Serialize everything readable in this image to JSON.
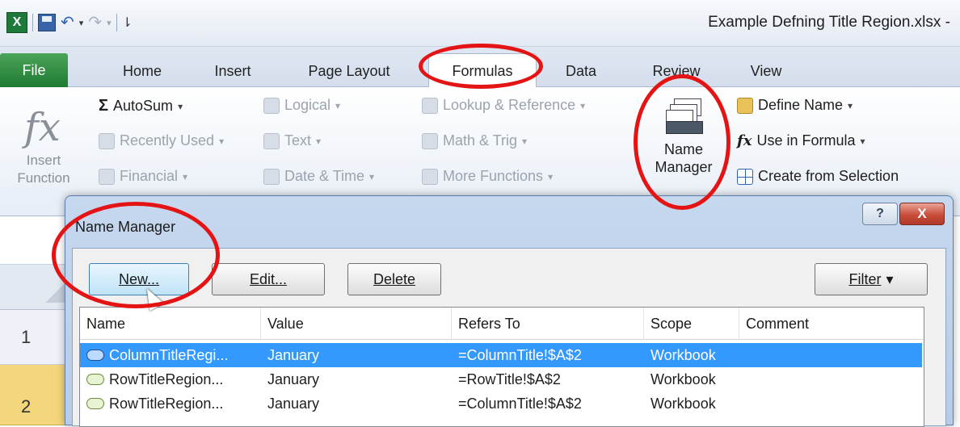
{
  "window": {
    "title": "Example Defning Title Region.xlsx -"
  },
  "qat": {
    "app_letter": "X",
    "undo_glyph": "↶",
    "redo_glyph": "↷",
    "dropdown_glyph": "▾",
    "customize_glyph": "⇂"
  },
  "tabs": [
    {
      "label": "File"
    },
    {
      "label": "Home"
    },
    {
      "label": "Insert"
    },
    {
      "label": "Page Layout"
    },
    {
      "label": "Formulas"
    },
    {
      "label": "Data"
    },
    {
      "label": "Review"
    },
    {
      "label": "View"
    }
  ],
  "ribbon": {
    "insert_function": {
      "glyph": "fx",
      "line1": "Insert",
      "line2": "Function"
    },
    "autosum": {
      "glyph": "Σ",
      "label": "AutoSum"
    },
    "recently_used": "Recently Used",
    "financial": "Financial",
    "logical": "Logical",
    "text": "Text",
    "date_time": "Date & Time",
    "lookup_reference": "Lookup & Reference",
    "math_trig": "Math & Trig",
    "more_functions": "More Functions",
    "name_manager": {
      "line1": "Name",
      "line2": "Manager"
    },
    "define_name": "Define Name",
    "use_in_formula": "Use in Formula",
    "create_from_selection": "Create from Selection",
    "caret": "▾",
    "fx_small": "fx"
  },
  "worksheet": {
    "rows": [
      "1",
      "2"
    ]
  },
  "dialog": {
    "title": "Name Manager",
    "help": "?",
    "close": "X",
    "buttons": {
      "new": "New...",
      "edit": "Edit...",
      "delete": "Delete",
      "filter": "Filter",
      "filter_caret": "▾"
    },
    "columns": [
      "Name",
      "Value",
      "Refers To",
      "Scope",
      "Comment"
    ],
    "rows": [
      {
        "name": "ColumnTitleRegi...",
        "value": "January",
        "refers_to": "=ColumnTitle!$A$2",
        "scope": "Workbook",
        "comment": "",
        "selected": true
      },
      {
        "name": "RowTitleRegion...",
        "value": "January",
        "refers_to": "=RowTitle!$A$2",
        "scope": "Workbook",
        "comment": "",
        "selected": false
      },
      {
        "name": "RowTitleRegion...",
        "value": "January",
        "refers_to": "=ColumnTitle!$A$2",
        "scope": "Workbook",
        "comment": "",
        "selected": false
      }
    ]
  },
  "colors": {
    "annotation": "#e41414",
    "file_tab": "#2e8b3e",
    "selection": "#3399ff",
    "row_header_selected": "#f4d67c"
  }
}
